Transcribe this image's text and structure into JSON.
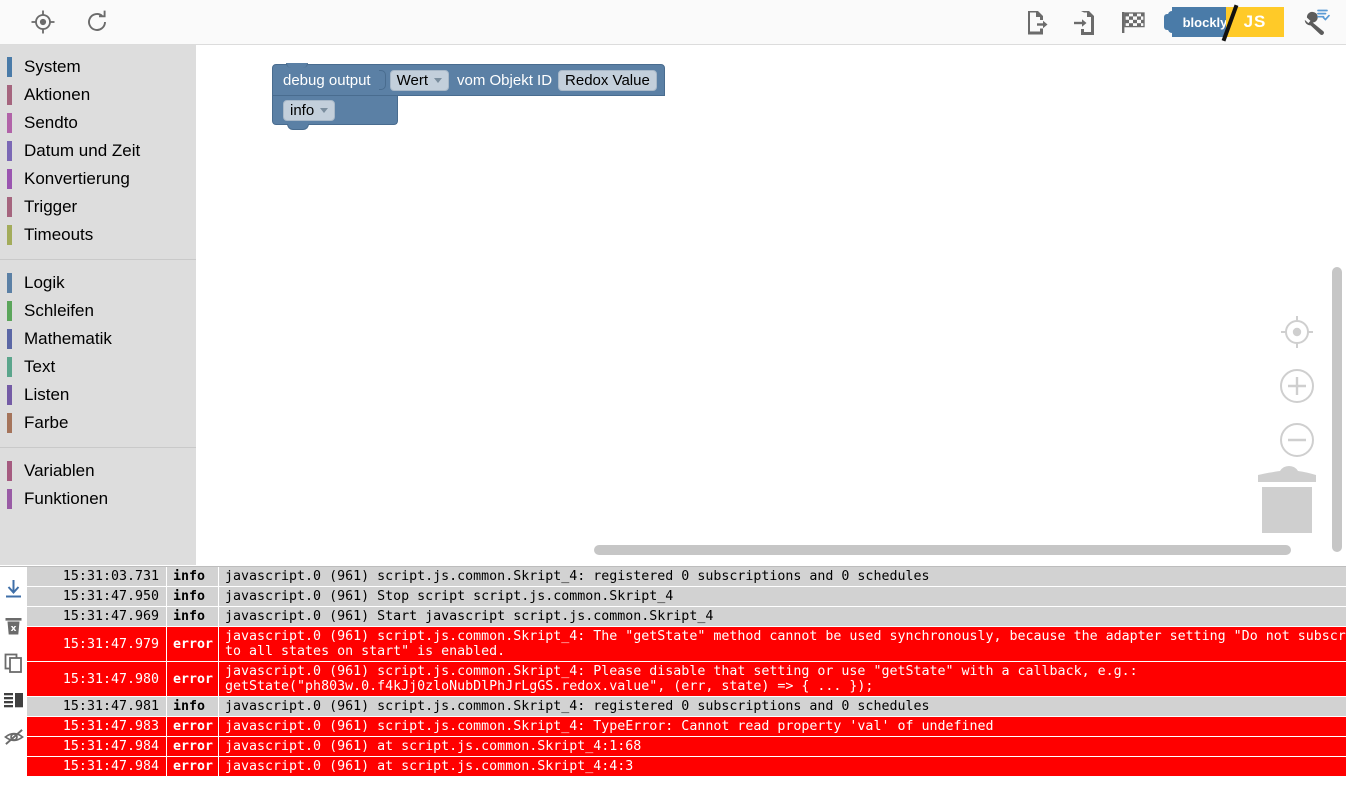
{
  "toolbar": {
    "left_buttons": [
      {
        "name": "center-view-icon",
        "title": "Center view"
      },
      {
        "name": "reload-icon",
        "title": "Reload"
      }
    ],
    "right_buttons": [
      {
        "name": "export-blocks-icon",
        "title": "Export blocks"
      },
      {
        "name": "import-blocks-icon",
        "title": "Import blocks"
      },
      {
        "name": "checkered-flag-icon",
        "title": "Run / Finish"
      }
    ],
    "lang_toggle": {
      "left_label": "blockly",
      "right_label": "JS"
    },
    "settings_button": {
      "name": "settings-wrench-icon",
      "title": "Settings"
    }
  },
  "sidebar": {
    "groups": [
      {
        "items": [
          {
            "label": "System",
            "color": "#4a7ba8"
          },
          {
            "label": "Aktionen",
            "color": "#a5657e"
          },
          {
            "label": "Sendto",
            "color": "#b163a8"
          },
          {
            "label": "Datum und Zeit",
            "color": "#7b68b5"
          },
          {
            "label": "Konvertierung",
            "color": "#9a55b0"
          },
          {
            "label": "Trigger",
            "color": "#a5657e"
          },
          {
            "label": "Timeouts",
            "color": "#a3ac5b"
          }
        ]
      },
      {
        "items": [
          {
            "label": "Logik",
            "color": "#5b80a5"
          },
          {
            "label": "Schleifen",
            "color": "#5ba55b"
          },
          {
            "label": "Mathematik",
            "color": "#5b67a5"
          },
          {
            "label": "Text",
            "color": "#5ba58c"
          },
          {
            "label": "Listen",
            "color": "#745ba5"
          },
          {
            "label": "Farbe",
            "color": "#a5745b"
          }
        ]
      },
      {
        "items": [
          {
            "label": "Variablen",
            "color": "#a55b80"
          },
          {
            "label": "Funktionen",
            "color": "#995ba5"
          }
        ]
      }
    ]
  },
  "workspace": {
    "block": {
      "name": "debug-output-block",
      "title": "debug output",
      "level_field": "info",
      "value_field": "Wert",
      "connector_text": "vom Objekt ID",
      "object_field": "Redox Value",
      "color": "#5b80a5"
    },
    "controls": [
      {
        "name": "center-workspace-icon"
      },
      {
        "name": "zoom-in-icon"
      },
      {
        "name": "zoom-out-icon"
      },
      {
        "name": "trashcan-icon"
      }
    ]
  },
  "log": {
    "tools": [
      {
        "name": "download-log-icon"
      },
      {
        "name": "clear-log-icon"
      },
      {
        "name": "copy-log-icon"
      },
      {
        "name": "toggle-layout-icon"
      },
      {
        "name": "hide-log-icon"
      }
    ],
    "rows": [
      {
        "time": "15:31:03.731",
        "severity": "info",
        "lines": [
          "javascript.0 (961) script.js.common.Skript_4: registered 0 subscriptions and 0 schedules"
        ]
      },
      {
        "time": "15:31:47.950",
        "severity": "info",
        "lines": [
          "javascript.0 (961) Stop script script.js.common.Skript_4"
        ]
      },
      {
        "time": "15:31:47.969",
        "severity": "info",
        "lines": [
          "javascript.0 (961) Start javascript script.js.common.Skript_4"
        ]
      },
      {
        "time": "15:31:47.979",
        "severity": "error",
        "lines": [
          "javascript.0 (961) script.js.common.Skript_4: The \"getState\" method cannot be used synchronously, because the adapter setting \"Do not subscribe",
          "to all states on start\" is enabled."
        ]
      },
      {
        "time": "15:31:47.980",
        "severity": "error",
        "lines": [
          "javascript.0 (961) script.js.common.Skript_4: Please disable that setting or use \"getState\" with a callback, e.g.:",
          "getState(\"ph803w.0.f4kJj0zloNubDlPhJrLgGS.redox.value\", (err, state) => { ... });"
        ]
      },
      {
        "time": "15:31:47.981",
        "severity": "info",
        "lines": [
          "javascript.0 (961) script.js.common.Skript_4: registered 0 subscriptions and 0 schedules"
        ]
      },
      {
        "time": "15:31:47.983",
        "severity": "error",
        "lines": [
          "javascript.0 (961) script.js.common.Skript_4: TypeError: Cannot read property 'val' of undefined"
        ]
      },
      {
        "time": "15:31:47.984",
        "severity": "error",
        "lines": [
          "javascript.0 (961) at script.js.common.Skript_4:1:68"
        ]
      },
      {
        "time": "15:31:47.984",
        "severity": "error",
        "lines": [
          "javascript.0 (961) at script.js.common.Skript_4:4:3"
        ]
      }
    ]
  },
  "colors": {
    "info_bg": "#d2d2d2",
    "error_bg": "#ff0000",
    "block_blue": "#5b80a5",
    "accent_yellow": "#ffca28",
    "toolbar_bg": "#fafafa",
    "sidebar_bg": "#dddddd"
  }
}
